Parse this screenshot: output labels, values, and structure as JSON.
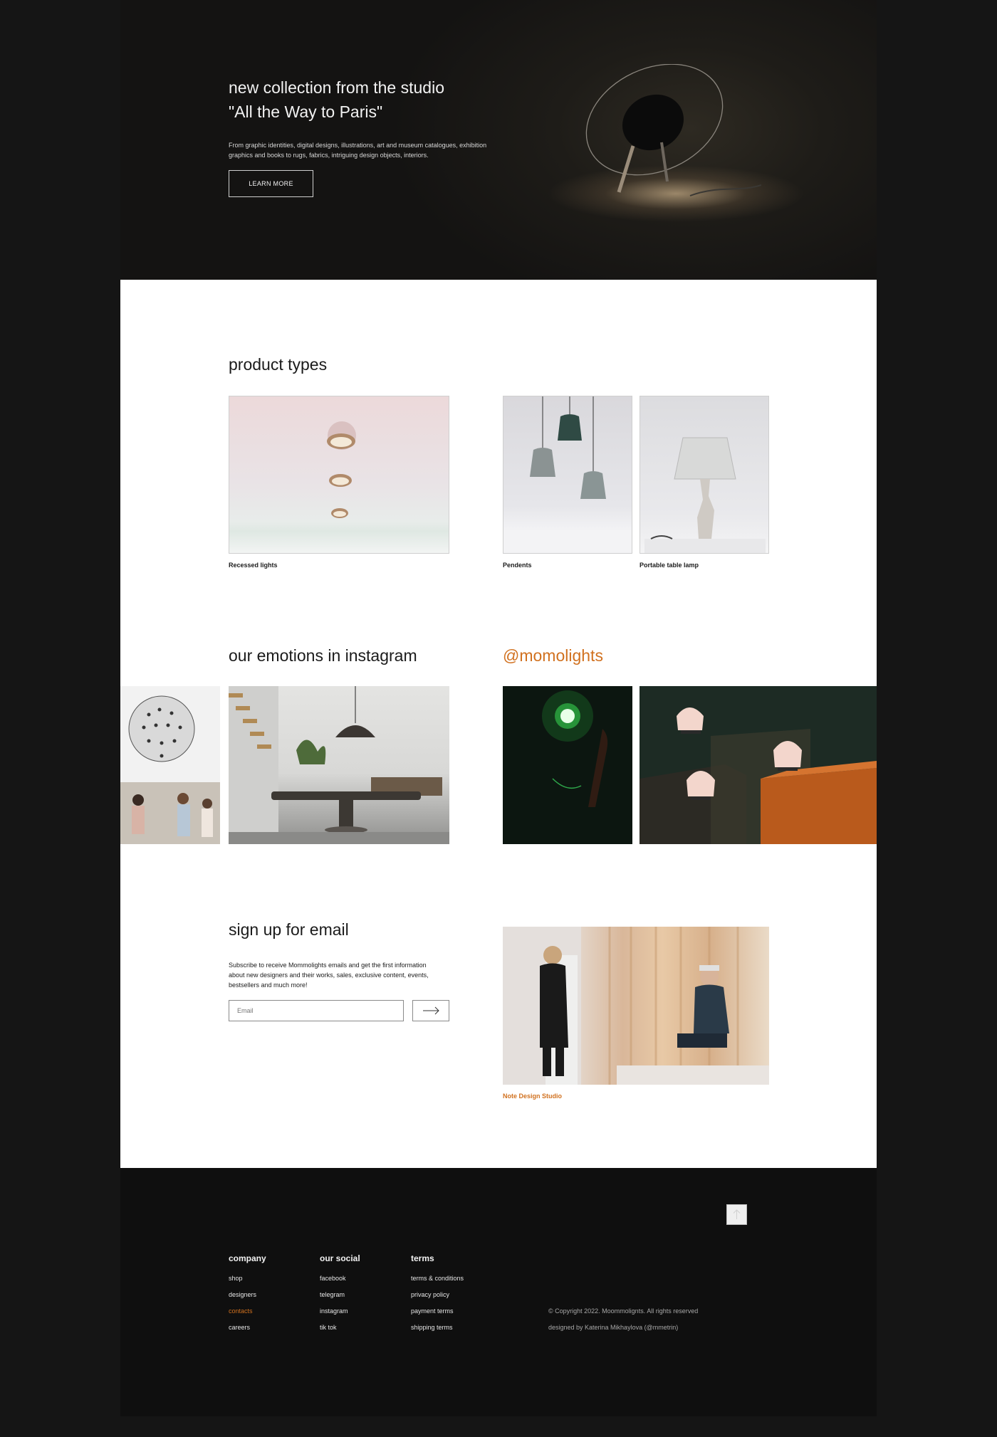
{
  "hero": {
    "title_line1": "new collection from the studio",
    "title_line2": "\"All the Way to Paris\"",
    "description": "From graphic identities, digital designs, illustrations, art and museum catalogues, exhibition graphics and books to rugs, fabrics, intriguing design objects, interiors.",
    "button_label": "LEARN MORE"
  },
  "product_types": {
    "heading": "product types",
    "items": [
      {
        "label": "Recessed lights"
      },
      {
        "label": "Pendents"
      },
      {
        "label": "Portable table lamp"
      }
    ]
  },
  "instagram": {
    "heading": "our emotions in instagram",
    "handle": "@momolights",
    "handle_color": "#d1711f"
  },
  "signup": {
    "heading": "sign up for email",
    "text": "Subscribe to receive Mommolights emails and get the first information about new designers and their works, sales, exclusive content, events, bestsellers and much more!",
    "email_placeholder": "Email",
    "submit_icon": "arrow-right-icon",
    "feature_caption": "Note Design Studio"
  },
  "footer": {
    "company": {
      "title": "company",
      "links": [
        "shop",
        "designers",
        "contacts",
        "careers"
      ],
      "active": "contacts"
    },
    "social": {
      "title": "our social",
      "links": [
        "facebook",
        "telegram",
        "instagram",
        "tik tok"
      ]
    },
    "terms": {
      "title": "terms",
      "links": [
        "terms & conditions",
        "privacy policy",
        "payment terms",
        "shipping terms"
      ]
    },
    "copyright": "© Copyright 2022. Moommolignts. All rights reserved",
    "credit": "designed by Katerina Mikhaylova (@mmetrin)",
    "scroll_top_icon": "arrow-up-icon",
    "accent_color": "#d1711f"
  }
}
